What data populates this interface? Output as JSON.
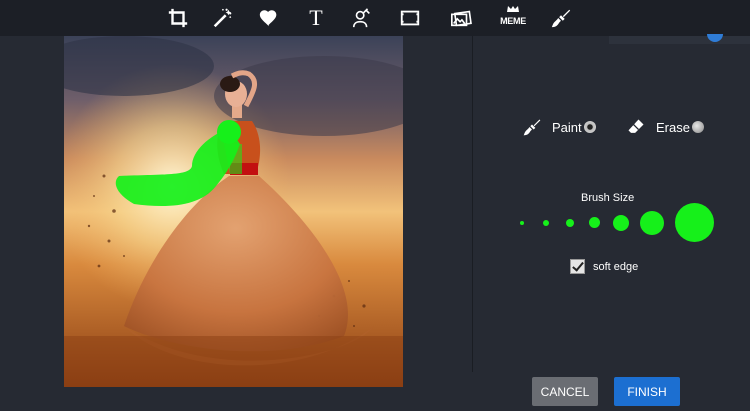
{
  "toolbar": {
    "tools": [
      {
        "name": "crop-icon"
      },
      {
        "name": "magic-wand-icon"
      },
      {
        "name": "heart-icon"
      },
      {
        "name": "text-icon",
        "label": "T"
      },
      {
        "name": "person-edit-icon"
      },
      {
        "name": "frame-icon"
      },
      {
        "name": "photos-icon"
      },
      {
        "name": "meme-icon",
        "label": "MEME"
      },
      {
        "name": "paint-brush-icon"
      }
    ]
  },
  "panel": {
    "paint_label": "Paint",
    "erase_label": "Erase",
    "mode_selected": "paint",
    "brush_size_label": "Brush Size",
    "brush_sizes": 7,
    "brush_selected_index": 6,
    "brush_color": "#16f01a",
    "soft_edge_label": "soft edge",
    "soft_edge_checked": true
  },
  "actions": {
    "cancel_label": "CANCEL",
    "finish_label": "FINISH"
  },
  "colors": {
    "background": "#262a33",
    "toolbar": "#1c1f26",
    "finish": "#1c6fd1",
    "cancel": "#6a6d73"
  }
}
